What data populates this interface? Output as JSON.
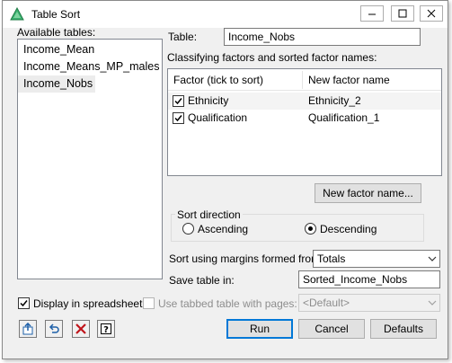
{
  "window": {
    "title": "Table Sort"
  },
  "available_tables": {
    "label": "Available tables:",
    "items": [
      "Income_Mean",
      "Income_Means_MP_males",
      "Income_Nobs"
    ],
    "selected": "Income_Nobs"
  },
  "table": {
    "label": "Table:",
    "value": "Income_Nobs"
  },
  "classifying": {
    "label": "Classifying factors and sorted factor names:",
    "columns": [
      "Factor (tick to sort)",
      "New factor name"
    ],
    "rows": [
      {
        "factor": "Ethnicity",
        "new_name": "Ethnicity_2",
        "checked": true
      },
      {
        "factor": "Qualification",
        "new_name": "Qualification_1",
        "checked": true
      }
    ]
  },
  "new_factor_button": "New factor name...",
  "sort_direction": {
    "label": "Sort direction",
    "ascending": "Ascending",
    "descending": "Descending",
    "selected": "Descending"
  },
  "margins": {
    "label": "Sort using margins formed from:",
    "value": "Totals"
  },
  "save_table": {
    "label": "Save table in:",
    "value": "Sorted_Income_Nobs"
  },
  "display_spreadsheet": {
    "label": "Display in spreadsheet",
    "checked": true
  },
  "tabbed": {
    "label": "Use tabbed table with pages:",
    "checked": false,
    "value": "<Default>"
  },
  "buttons": {
    "run": "Run",
    "cancel": "Cancel",
    "defaults": "Defaults"
  },
  "colors": {
    "accent": "#0078d7",
    "selection": "#ececec",
    "dialog_bg": "#f0f0f0"
  }
}
